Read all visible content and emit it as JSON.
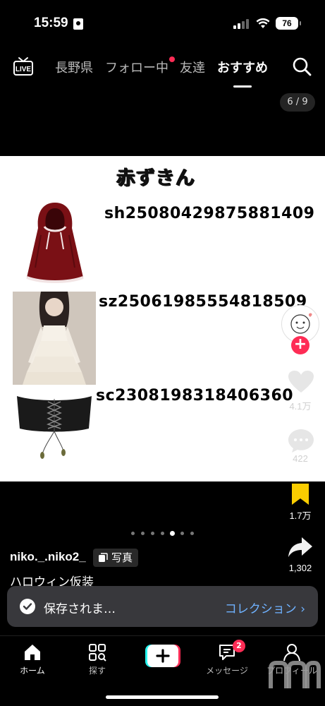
{
  "status_bar": {
    "time": "15:59",
    "battery": "76"
  },
  "top_nav": {
    "tabs": [
      {
        "label": "長野県"
      },
      {
        "label": "フォロー中"
      },
      {
        "label": "友達"
      },
      {
        "label": "おすすめ"
      }
    ],
    "active_tab": "おすすめ"
  },
  "post": {
    "counter": "6 / 9",
    "card": {
      "title": "赤ずきん",
      "items": [
        {
          "code": "sh25080429875881409",
          "image": "red-hooded-cape"
        },
        {
          "code": "sz25061985554818509",
          "image": "white-tiered-dress"
        },
        {
          "code": "sc23081983184063​60",
          "image": "black-corset-belt"
        }
      ]
    },
    "likes": "4.1万",
    "comments": "422",
    "favorites": "1.7万",
    "shares": "1,302",
    "page_dots": {
      "total": 7,
      "active": 4
    },
    "username": "niko._.niko2_",
    "badge": "写真",
    "caption": "ハロウィン仮装"
  },
  "toast": {
    "message": "保存されま…",
    "action": "コレクション"
  },
  "bottom_nav": {
    "home": "ホーム",
    "explore": "探す",
    "messages": "メッセージ",
    "messages_badge": "2",
    "profile": "プロフィール"
  },
  "colors": {
    "accent": "#fe2c55",
    "favorite": "#facd00",
    "link": "#6fb2ff"
  }
}
